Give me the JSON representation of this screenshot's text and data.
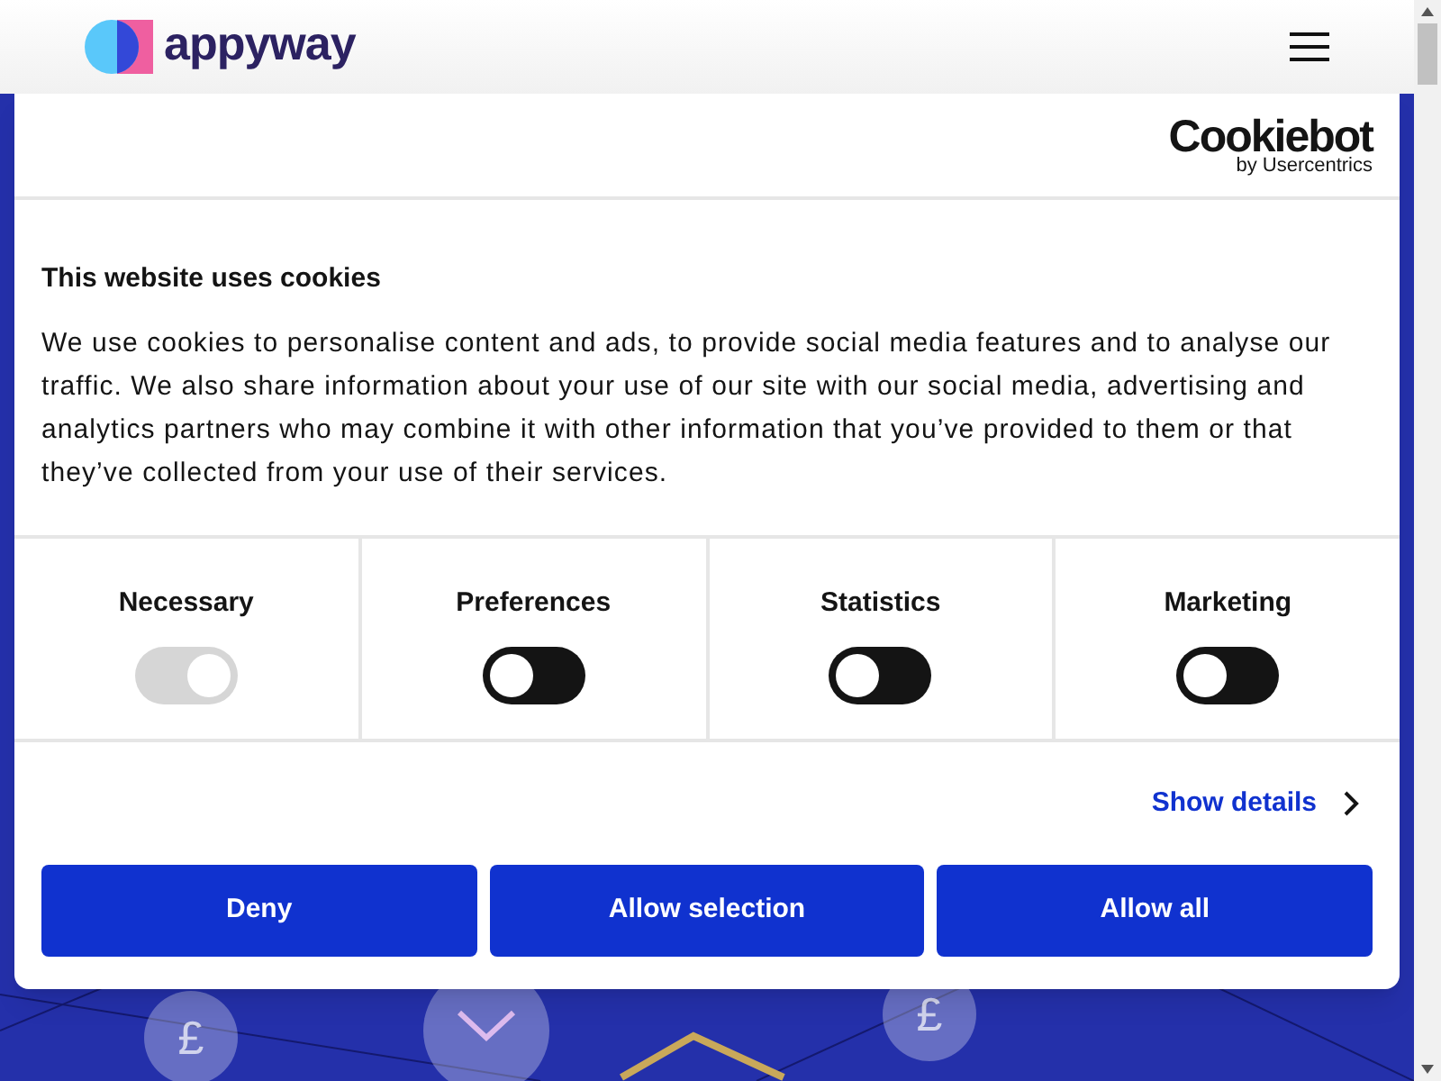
{
  "header": {
    "logo_text": "appyway"
  },
  "dialog": {
    "brand": {
      "name": "Cookiebot",
      "byline": "by Usercentrics"
    },
    "title": "This website uses cookies",
    "body": "We use cookies to personalise content and ads, to provide social media features and to analyse our traffic. We also share information about your use of our site with our social media, advertising and analytics partners who may combine it with other information that you’ve provided to them or that they’ve collected from your use of their services.",
    "categories": [
      {
        "label": "Necessary",
        "checked": true,
        "disabled": true
      },
      {
        "label": "Preferences",
        "checked": false,
        "disabled": false
      },
      {
        "label": "Statistics",
        "checked": false,
        "disabled": false
      },
      {
        "label": "Marketing",
        "checked": false,
        "disabled": false
      }
    ],
    "details_link": "Show details",
    "buttons": [
      "Deny",
      "Allow selection",
      "Allow all"
    ]
  },
  "background": {
    "coin_labels": [
      "£",
      "£"
    ]
  }
}
